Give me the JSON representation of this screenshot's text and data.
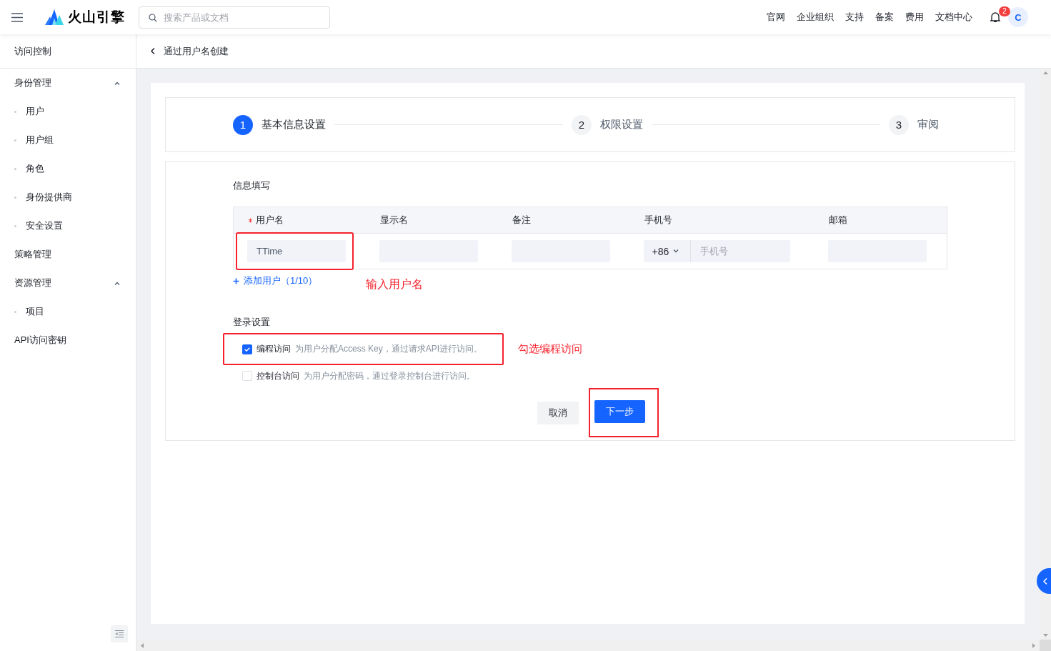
{
  "header": {
    "logo": "火山引擎",
    "search": {
      "placeholder": "搜索产品或文档"
    },
    "nav": [
      "官网",
      "企业组织",
      "支持",
      "备案",
      "费用",
      "文档中心"
    ],
    "notifications": "2",
    "avatar": "C"
  },
  "sidebar": {
    "title": "访问控制",
    "items": [
      {
        "label": "身份管理",
        "expanded": true,
        "children": [
          {
            "label": "用户"
          },
          {
            "label": "用户组"
          },
          {
            "label": "角色"
          },
          {
            "label": "身份提供商"
          },
          {
            "label": "安全设置"
          }
        ]
      },
      {
        "label": "策略管理"
      },
      {
        "label": "资源管理",
        "expanded": true,
        "children": [
          {
            "label": "项目"
          }
        ]
      },
      {
        "label": "API访问密钥"
      }
    ]
  },
  "breadcrumb": {
    "title": "通过用户名创建"
  },
  "steps": [
    {
      "number": "1",
      "label": "基本信息设置",
      "selected": true
    },
    {
      "number": "2",
      "label": "权限设置",
      "selected": false
    },
    {
      "number": "3",
      "label": "审阅",
      "selected": false
    }
  ],
  "user_info": {
    "title": "信息填写",
    "columns": [
      {
        "label": "用户名",
        "required": true
      },
      {
        "label": "显示名",
        "required": false
      },
      {
        "label": "备注",
        "required": false
      },
      {
        "label": "手机号",
        "required": false
      },
      {
        "label": "邮箱",
        "required": false
      }
    ],
    "cells": [
      {
        "kind": "text",
        "value": "TTime",
        "highlighted": true
      },
      {
        "kind": "text",
        "highlighted": false
      },
      {
        "kind": "text",
        "highlighted": false
      },
      {
        "kind": "phone",
        "prefix": "+86",
        "placeholder": "手机号",
        "highlighted": false
      },
      {
        "kind": "text",
        "highlighted": false
      }
    ],
    "add_user": "添加用户（1/10）",
    "note": "输入用户名"
  },
  "login": {
    "title": "登录设置",
    "options": [
      {
        "label": "编程访问",
        "description": "为用户分配Access Key，通过请求API进行访问。",
        "checked": true,
        "highlighted": true
      },
      {
        "label": "控制台访问",
        "description": "为用户分配密码，通过登录控制台进行访问。",
        "checked": false,
        "highlighted": false
      }
    ],
    "note": "勾选编程访问"
  },
  "buttons": [
    {
      "kind": "secondary",
      "label": "取消",
      "highlighted": false
    },
    {
      "kind": "primary",
      "label": "下一步",
      "highlighted": true
    }
  ]
}
